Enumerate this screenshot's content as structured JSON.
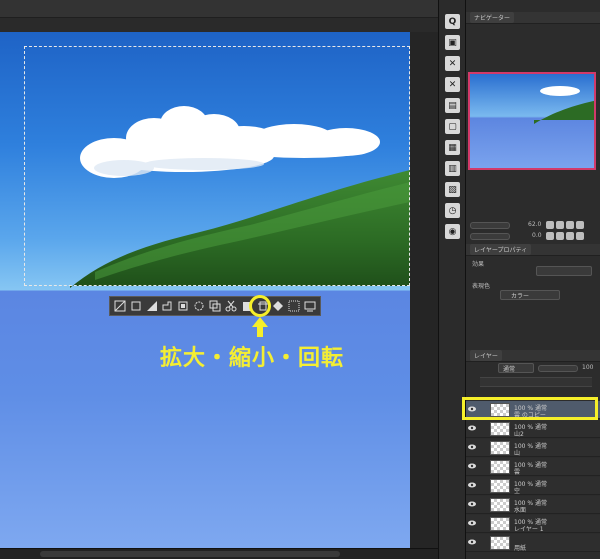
{
  "canvas": {
    "caption": "拡大・縮小・回転"
  },
  "selection_toolbar": {
    "buttons": [
      {
        "name": "clear-outside-icon"
      },
      {
        "name": "crop-icon"
      },
      {
        "name": "fill-icon"
      },
      {
        "name": "expand-selection-icon"
      },
      {
        "name": "shrink-selection-icon"
      },
      {
        "name": "settings-icon"
      },
      {
        "name": "copy-paste-icon"
      },
      {
        "name": "cut-paste-icon"
      },
      {
        "name": "paste-icon"
      },
      {
        "name": "scale-rotate-icon"
      },
      {
        "name": "fill-selection-icon"
      },
      {
        "name": "new-layer-fill-icon"
      },
      {
        "name": "deselect-icon"
      }
    ]
  },
  "tool_strip": {
    "buttons": [
      "zoom-icon",
      "layer-new-icon",
      "layer-delete-icon",
      "close-icon",
      "copy-icon",
      "display-icon",
      "grid-icon",
      "panel-icon",
      "ruler-icon",
      "history-icon",
      "camera-icon"
    ]
  },
  "navigator": {
    "tab_label": "ナビゲーター",
    "zoom_value": "62.0",
    "rotate_value": "0.0"
  },
  "layer_property": {
    "tab_label": "レイヤープロパティ",
    "effect_label": "効果",
    "expression_color_label": "表現色",
    "expression_color_value": "カラー"
  },
  "layers": {
    "tab_label": "レイヤー",
    "blend_mode": "通常",
    "opacity": "100",
    "items": [
      {
        "line1": "100 % 通常",
        "line2": "雲 のコピー",
        "selected": true
      },
      {
        "line1": "100 % 通常",
        "line2": "山2",
        "selected": false
      },
      {
        "line1": "100 % 通常",
        "line2": "山",
        "selected": false
      },
      {
        "line1": "100 % 通常",
        "line2": "雲",
        "selected": false
      },
      {
        "line1": "100 % 通常",
        "line2": "空",
        "selected": false
      },
      {
        "line1": "100 % 通常",
        "line2": "水面",
        "selected": false
      },
      {
        "line1": "100 % 通常",
        "line2": "レイヤー 1",
        "selected": false
      },
      {
        "line1": "",
        "line2": "用紙",
        "selected": false
      }
    ]
  },
  "colors": {
    "highlight": "#f5ef2a",
    "nav_frame": "#d23a6a",
    "selected_layer": "#4f5b6c"
  }
}
